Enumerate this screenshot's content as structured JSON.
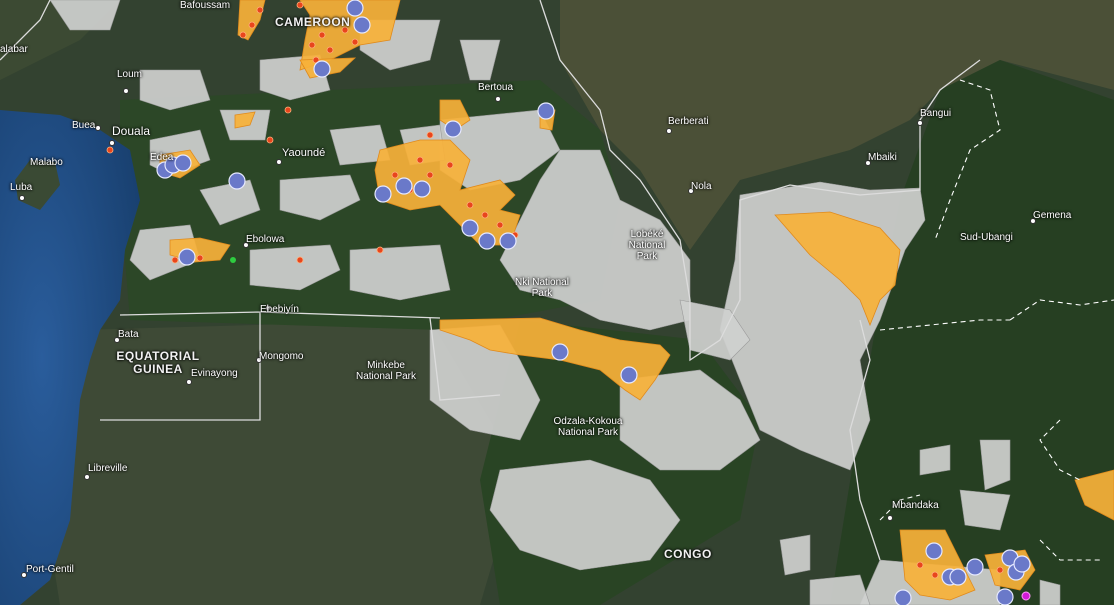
{
  "map": {
    "colors": {
      "ocean": "#1f4f86",
      "forest": "#2e4a26",
      "savanna": "#4a5236",
      "concession": "#cfd0cf",
      "alert": "#f7b13a",
      "marker": "#6a79c9",
      "fire": "#e8451c"
    },
    "countries": {
      "cameroon": "CAMEROON",
      "equatorial_guinea": "EQUATORIAL GUINEA",
      "congo": "CONGO"
    },
    "cities": {
      "bafoussam": "Bafoussam",
      "kalabar": "alabar",
      "loum": "Loum",
      "buea": "Buea",
      "douala": "Douala",
      "malabo": "Malabo",
      "luba": "Luba",
      "edea": "Edea",
      "yaounde": "Yaoundé",
      "bertoua": "Bertoua",
      "berberati": "Berberati",
      "bangui": "Bangui",
      "mbaiki": "Mbaiki",
      "nola": "Nola",
      "gemena": "Gemena",
      "sud_ubangi": "Sud-Ubangi",
      "ebolowa": "Ebolowa",
      "ebebiyin": "Ebebiyín",
      "bata": "Bata",
      "mongomo": "Mongomo",
      "evinayong": "Evinayong",
      "libreville": "Libreville",
      "port_gentil": "Port-Gentil",
      "mbandaka": "Mbandaka"
    },
    "parks": {
      "lobeke": "Lobéké National Park",
      "nki": "Nki National Park",
      "minkebe": "Minkebe National Park",
      "odzala": "Odzala-Kokoua National Park"
    }
  }
}
